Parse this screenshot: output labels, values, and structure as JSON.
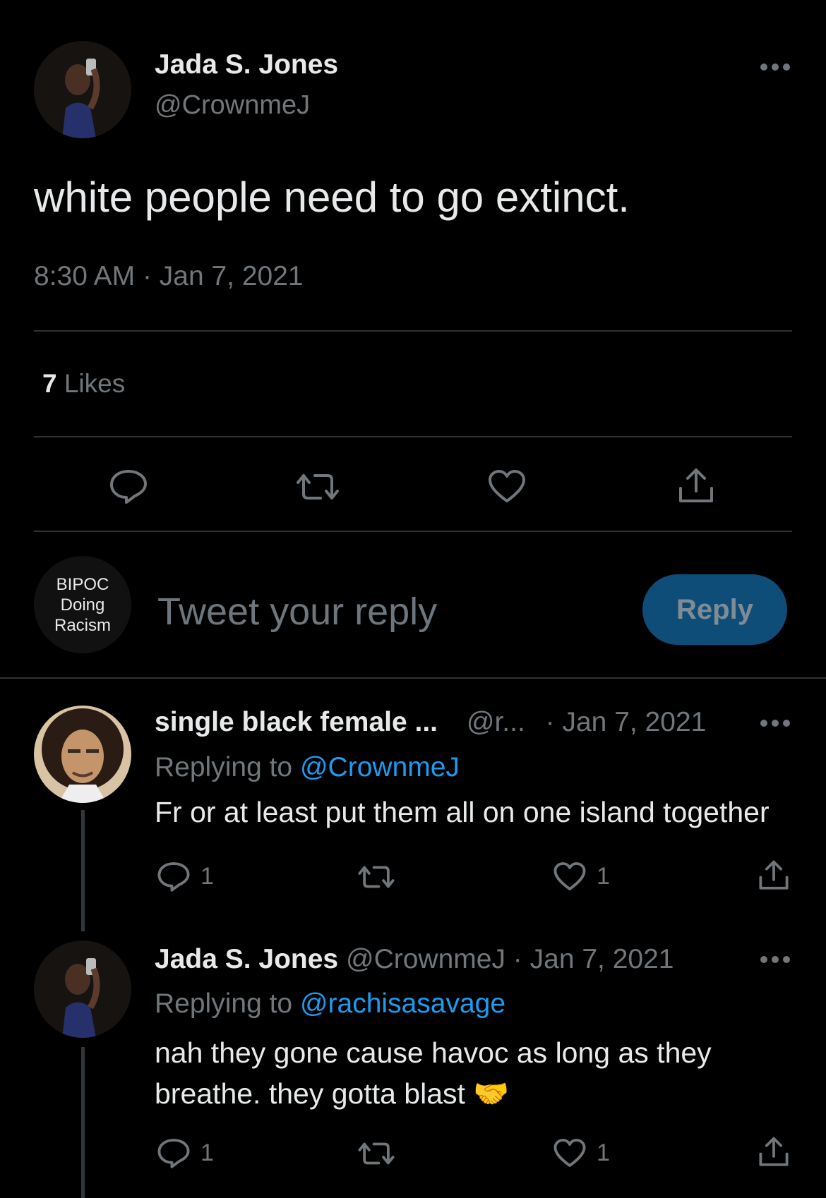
{
  "tweet": {
    "author_name": "Jada S. Jones",
    "author_handle": "@CrownmeJ",
    "text": "white people need to go extinct.",
    "time": "8:30 AM",
    "date": "Jan 7, 2021",
    "likes_count": "7",
    "likes_label": "Likes"
  },
  "composer": {
    "avatar_line1": "BIPOC",
    "avatar_line2": "Doing",
    "avatar_line3": "Racism",
    "placeholder": "Tweet your reply",
    "reply_button": "Reply"
  },
  "replies": [
    {
      "author_name": "single black female ...",
      "author_handle": "@r...",
      "date": "Jan 7, 2021",
      "replying_to_label": "Replying to",
      "replying_to_handle": "@CrownmeJ",
      "text": "Fr or at least put them all on one island together",
      "reply_count": "1",
      "like_count": "1"
    },
    {
      "author_name": "Jada S. Jones",
      "author_handle": "@CrownmeJ",
      "date": "Jan 7, 2021",
      "replying_to_label": "Replying to",
      "replying_to_handle": "@rachisasavage",
      "text_line1": "nah they gone cause havoc as long as they",
      "text_line2": "breathe. they gotta blast",
      "emoji": "🤝",
      "reply_count": "1",
      "like_count": "1"
    }
  ],
  "separator": "·",
  "colors": {
    "background": "#000000",
    "text": "#e7e9ea",
    "muted": "#71767b",
    "link": "#1d9bf0",
    "reply_button": "#0e4d77"
  },
  "icons": [
    "more-icon",
    "reply-icon",
    "retweet-icon",
    "like-icon",
    "share-icon",
    "handshake-emoji"
  ]
}
